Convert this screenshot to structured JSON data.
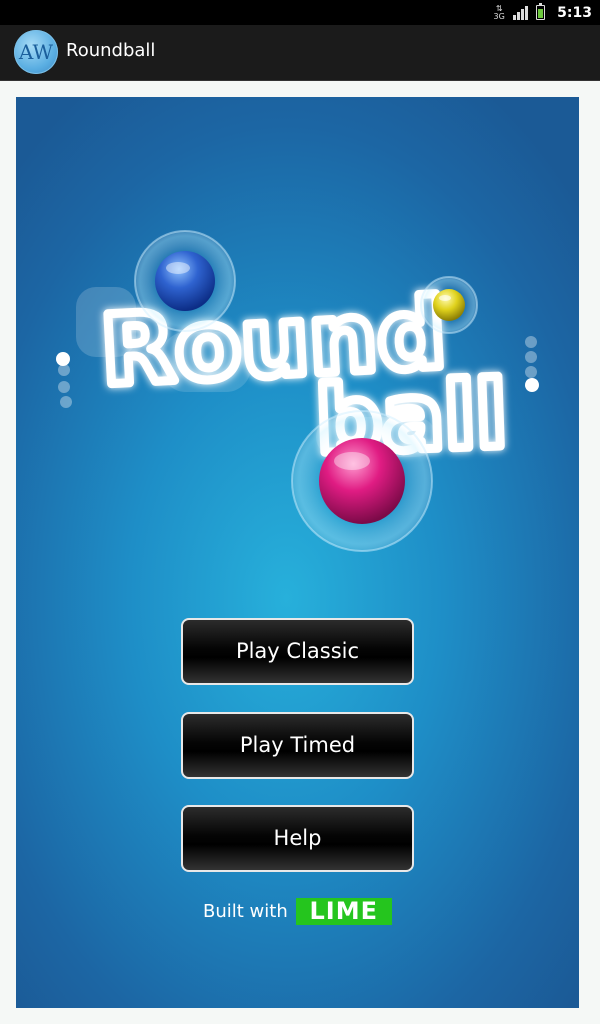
{
  "status_bar": {
    "network_type": "3G",
    "time": "5:13",
    "icons": [
      "data-transfer-icon",
      "signal-icon",
      "battery-charging-icon"
    ]
  },
  "title_bar": {
    "app_icon_text": "AW",
    "title": "Roundball"
  },
  "game": {
    "logo": {
      "word1": "Round",
      "word2": "ball",
      "balls": [
        "blue-ball",
        "yellow-ball",
        "pink-ball"
      ]
    },
    "menu": {
      "play_classic": "Play Classic",
      "play_timed": "Play Timed",
      "help": "Help"
    },
    "footer": {
      "built_with": "Built with",
      "engine": "LIME"
    }
  },
  "colors": {
    "background_center": "#27b0db",
    "background_edge": "#1b5a96",
    "lime_green": "#25c51e",
    "button_black": "#000000"
  }
}
